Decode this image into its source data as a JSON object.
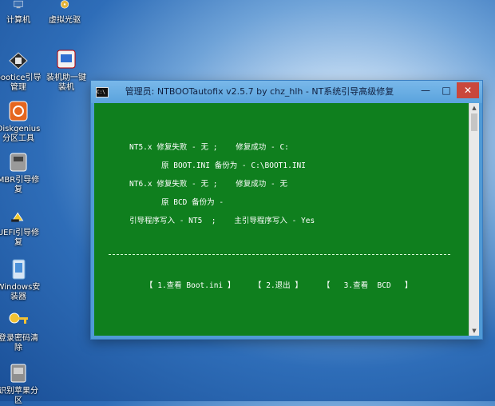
{
  "desktop": {
    "icons": [
      {
        "label": "计算机"
      },
      {
        "label": "虚拟光驱"
      },
      {
        "label": "bootice引导管理"
      },
      {
        "label": "装机助一键装机"
      },
      {
        "label": "Diskgenius分区工具"
      },
      {
        "label": "MBR引导修复"
      },
      {
        "label": "UEFI引导修复"
      },
      {
        "label": "Windows安装器"
      },
      {
        "label": "登录密码清除"
      },
      {
        "label": "识别苹果分区"
      }
    ]
  },
  "window": {
    "app_icon_text": "C:\\",
    "title": "管理员:  NTBOOTautofix v2.5.7 by chz_hlh - NT系统引导高级修复",
    "minimize": "—",
    "maximize": "□",
    "close": "✕"
  },
  "console": {
    "nt5_line": "NT5.x 修复失败 - 无 ;    修复成功 - C:",
    "nt5_backup": "原 BOOT.INI 备份为 - C:\\BOOT1.INI",
    "nt6_line": "NT6.x 修复失败 - 无 ;    修复成功 - 无",
    "nt6_backup": "原 BCD 备份为 -",
    "boot_write": "引导程序写入 - NT5  ;    主引导程序写入 - Yes",
    "menu_view_boot": "【 1.查看 Boot.ini 】",
    "menu_exit": "【 2.退出 】",
    "menu_view_bcd": "【   3.查看  BCD   】"
  }
}
